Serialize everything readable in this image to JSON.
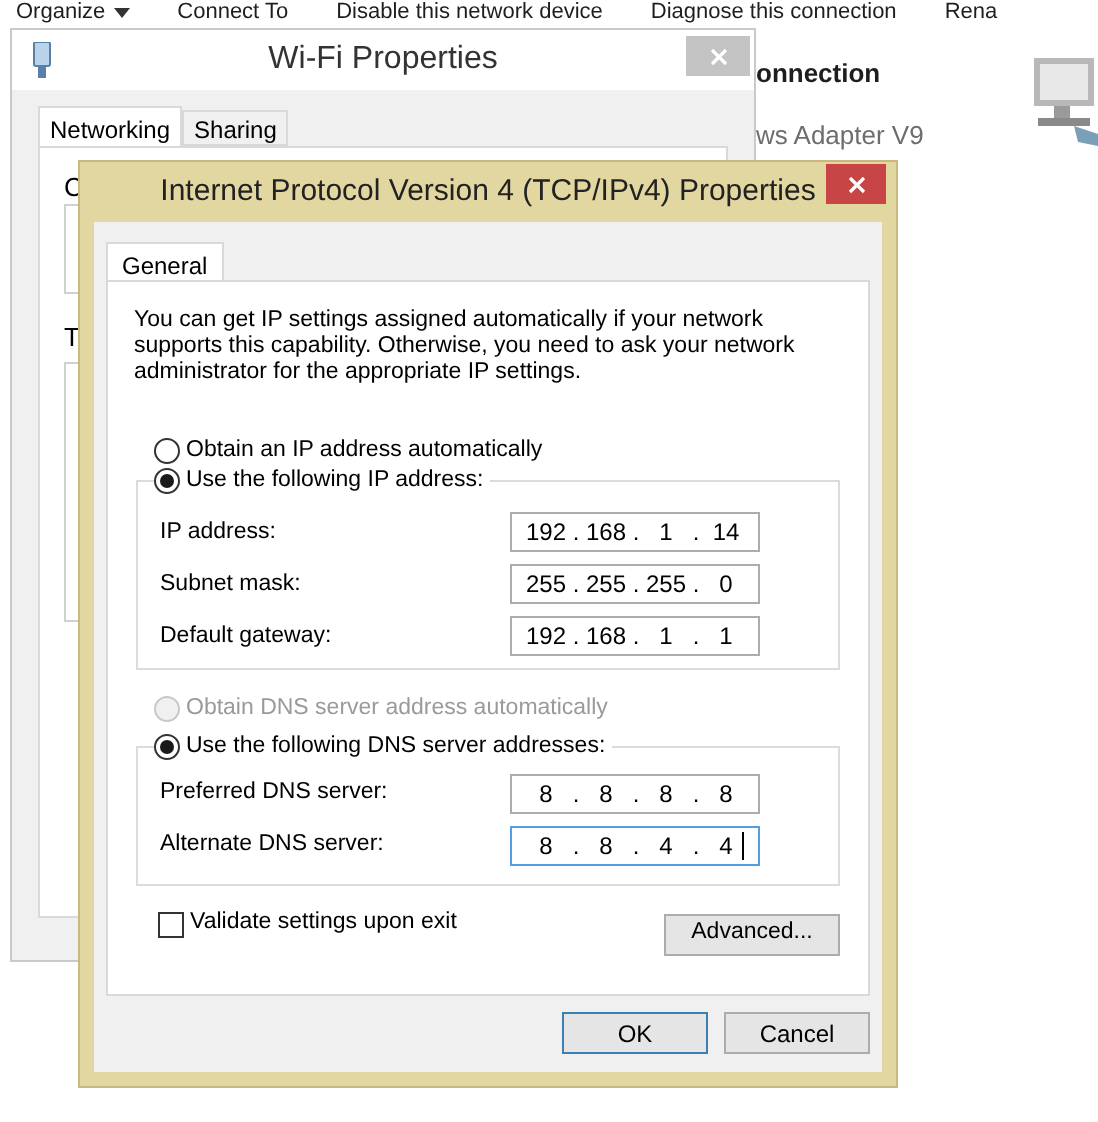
{
  "background_toolbar": [
    {
      "label": "Organize",
      "dropdown": true
    },
    {
      "label": "Connect To",
      "dropdown": false
    },
    {
      "label": "Disable this network device",
      "dropdown": false
    },
    {
      "label": "Diagnose this connection",
      "dropdown": false
    },
    {
      "label": "Rena",
      "dropdown": false
    }
  ],
  "background_details": {
    "name": "onnection",
    "device": "ws Adapter V9"
  },
  "wifi_window": {
    "title": "Wi-Fi Properties",
    "tabs": [
      {
        "label": "Networking",
        "selected": true
      },
      {
        "label": "Sharing",
        "selected": false
      }
    ],
    "partial_labels": [
      "C",
      "T"
    ]
  },
  "ipv4_dialog": {
    "title": "Internet Protocol Version 4 (TCP/IPv4) Properties",
    "tabs": [
      {
        "label": "General",
        "selected": true
      }
    ],
    "intro": "You can get IP settings assigned automatically if your network supports this capability. Otherwise, you need to ask your network administrator for the appropriate IP settings.",
    "separator": ".",
    "ip_options": [
      {
        "label": "Obtain an IP address automatically",
        "selected": false,
        "disabled": false
      },
      {
        "label": "Use the following IP address:",
        "selected": true,
        "disabled": false
      }
    ],
    "ip_fields": [
      {
        "label": "IP address:",
        "octets": [
          "192",
          "168",
          "1",
          "14"
        ],
        "focused": false
      },
      {
        "label": "Subnet mask:",
        "octets": [
          "255",
          "255",
          "255",
          "0"
        ],
        "focused": false
      },
      {
        "label": "Default gateway:",
        "octets": [
          "192",
          "168",
          "1",
          "1"
        ],
        "focused": false
      }
    ],
    "dns_options": [
      {
        "label": "Obtain DNS server address automatically",
        "selected": false,
        "disabled": true
      },
      {
        "label": "Use the following DNS server addresses:",
        "selected": true,
        "disabled": false
      }
    ],
    "dns_fields": [
      {
        "label": "Preferred DNS server:",
        "octets": [
          "8",
          "8",
          "8",
          "8"
        ],
        "focused": false
      },
      {
        "label": "Alternate DNS server:",
        "octets": [
          "8",
          "8",
          "4",
          "4"
        ],
        "focused": true
      }
    ],
    "validate": {
      "label": "Validate settings upon exit",
      "checked": false
    },
    "advanced_button": "Advanced...",
    "buttons": [
      {
        "label": "OK",
        "default": true
      },
      {
        "label": "Cancel",
        "default": false
      }
    ]
  }
}
